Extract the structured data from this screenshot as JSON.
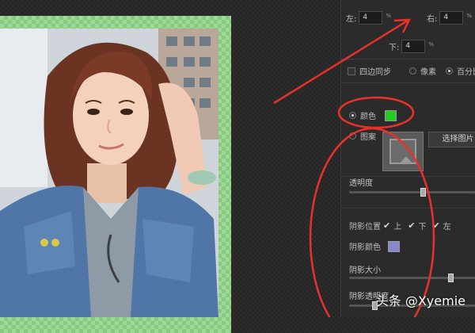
{
  "margins": {
    "left_label": "左:",
    "left_value": "4",
    "right_label": "右:",
    "right_value": "4",
    "bottom_label": "下:",
    "bottom_value": "4",
    "unit": "%"
  },
  "options": {
    "sync_label": "四边同步",
    "pixel_label": "像素",
    "percent_label": "百分比"
  },
  "fill": {
    "color_label": "颜色",
    "color_value": "#22cc22",
    "pattern_label": "图案",
    "select_image_label": "选择图片"
  },
  "opacity": {
    "label": "透明度",
    "level": 0.58
  },
  "shadow": {
    "position_label": "阴影位置",
    "top_label": "上",
    "bottom_label": "下",
    "left_label": "左",
    "color_label": "阴影颜色",
    "color_value": "#8a88cc",
    "size_label": "阴影大小",
    "size_level": 0.8,
    "opacity_label": "阴影透明度",
    "opacity_level": 0.2
  },
  "watermark": {
    "text": "头条 @Xyemie"
  },
  "colors": {
    "annotation": "#e8312a",
    "panel_bg": "#2b2b2b",
    "border_green": "#9fd99a"
  }
}
